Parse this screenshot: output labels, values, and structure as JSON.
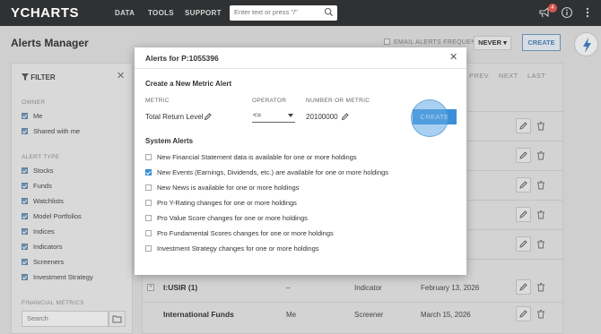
{
  "topbar": {
    "logo": "YCHARTS",
    "nav": [
      "DATA",
      "TOOLS",
      "SUPPORT"
    ],
    "search_placeholder": "Enter text or press \"/\"",
    "notification_count": "4"
  },
  "page": {
    "title": "Alerts Manager",
    "email_freq_label": "EMAIL ALERTS FREQUENCY:",
    "email_freq_value": "NEVER",
    "create_label": "CREATE"
  },
  "filter": {
    "title": "FILTER",
    "owner_label": "OWNER",
    "owner_items": [
      "Me",
      "Shared with me"
    ],
    "alert_type_label": "ALERT TYPE",
    "alert_types": [
      "Stocks",
      "Funds",
      "Watchlists",
      "Model Portfolios",
      "Indices",
      "Indicators",
      "Screeners",
      "Investment Strategy"
    ],
    "metrics_label": "FINANCIAL METRICS",
    "search_placeholder": "Search"
  },
  "table": {
    "pagination": [
      "PREV",
      "NEXT",
      "LAST"
    ],
    "rows": [
      {
        "name": "I:USIR (1)",
        "owner": "–",
        "type": "Indicator",
        "date": "February 13, 2026"
      },
      {
        "name": "International Funds",
        "owner": "Me",
        "type": "Screener",
        "date": "March 15, 2026"
      }
    ]
  },
  "modal": {
    "title": "Alerts for P:1055396",
    "section_new": "Create a New Metric Alert",
    "metric_label": "METRIC",
    "metric_value": "Total Return Level",
    "operator_label": "OPERATOR",
    "operator_value": "<=",
    "number_label": "NUMBER OR METRIC",
    "number_value": "20100000",
    "create_label": "CREATE",
    "section_system": "System Alerts",
    "system_alerts": [
      {
        "label": "New Financial Statement data is available for one or more holdings",
        "checked": false
      },
      {
        "label": "New Events (Earnings, Dividends, etc.) are available for one or more holdings",
        "checked": true
      },
      {
        "label": "New News is available for one or more holdings",
        "checked": false
      },
      {
        "label": "Pro Y-Rating changes for one or more holdings",
        "checked": false
      },
      {
        "label": "Pro Value Score changes for one or more holdings",
        "checked": false
      },
      {
        "label": "Pro Fundamental Scores changes for one or more holdings",
        "checked": false
      },
      {
        "label": "Investment Strategy changes for one or more holdings",
        "checked": false
      }
    ]
  },
  "icons": {
    "search": "search-icon",
    "announce": "megaphone-icon",
    "help": "help-icon",
    "menu": "kebab-menu-icon",
    "bolt": "lightning-icon",
    "pencil": "pencil-icon",
    "trash": "trash-icon",
    "folder": "folder-icon",
    "close": "close-icon",
    "funnel": "funnel-icon"
  }
}
